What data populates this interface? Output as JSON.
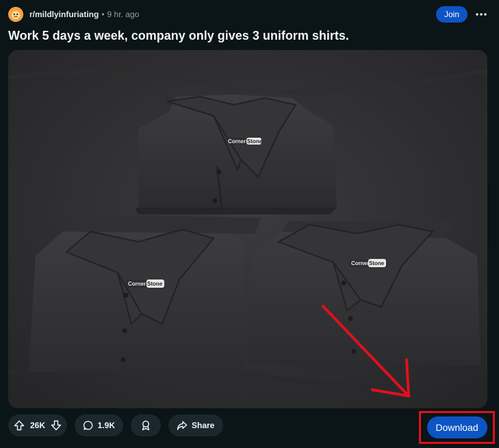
{
  "post": {
    "subreddit": "r/mildlyinfuriating",
    "separator": "•",
    "time": "9 hr. ago",
    "join_label": "Join",
    "title": "Work 5 days a week, company only gives 3 uniform shirts.",
    "image_label_brand": "Corner Stone",
    "colors": {
      "background": "#0b1416",
      "join": "#0d54c4",
      "annotation_red": "#e0111b",
      "pill": "#1a282d"
    }
  },
  "actions": {
    "upvotes": "26K",
    "comments": "1.9K",
    "share_label": "Share",
    "download_label": "Download",
    "icons": [
      "upvote-icon",
      "downvote-icon",
      "comment-icon",
      "award-icon",
      "share-icon"
    ]
  }
}
